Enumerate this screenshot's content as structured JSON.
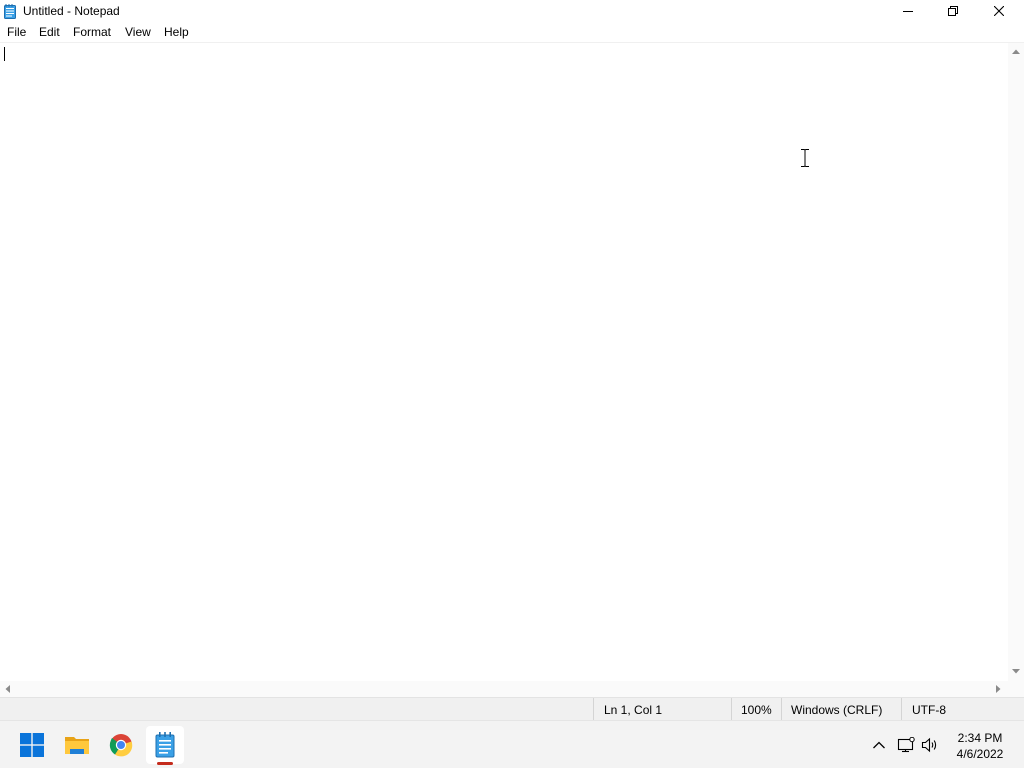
{
  "window": {
    "title": "Untitled - Notepad",
    "controls": {
      "minimize": "minimize",
      "maximize": "restore",
      "close": "close"
    }
  },
  "menu": {
    "items": [
      {
        "label": "File"
      },
      {
        "label": "Edit"
      },
      {
        "label": "Format"
      },
      {
        "label": "View"
      },
      {
        "label": "Help"
      }
    ]
  },
  "editor": {
    "text": "",
    "cursor": "i-beam"
  },
  "status": {
    "position": "Ln 1, Col 1",
    "zoom": "100%",
    "line_ending": "Windows (CRLF)",
    "encoding": "UTF-8"
  },
  "taskbar": {
    "apps": [
      {
        "name": "start-icon"
      },
      {
        "name": "file-explorer-icon"
      },
      {
        "name": "chrome-icon"
      },
      {
        "name": "notepad-icon",
        "active": true
      }
    ],
    "tray": {
      "icons": [
        "chevron-up-icon",
        "network-icon",
        "volume-icon"
      ],
      "time": "2:34 PM",
      "date": "4/6/2022"
    }
  },
  "colors": {
    "accent": "#0078d4",
    "active_indicator": "#c42b1c",
    "status_bar": "#f0f0f0",
    "taskbar": "#f3f3f3"
  }
}
